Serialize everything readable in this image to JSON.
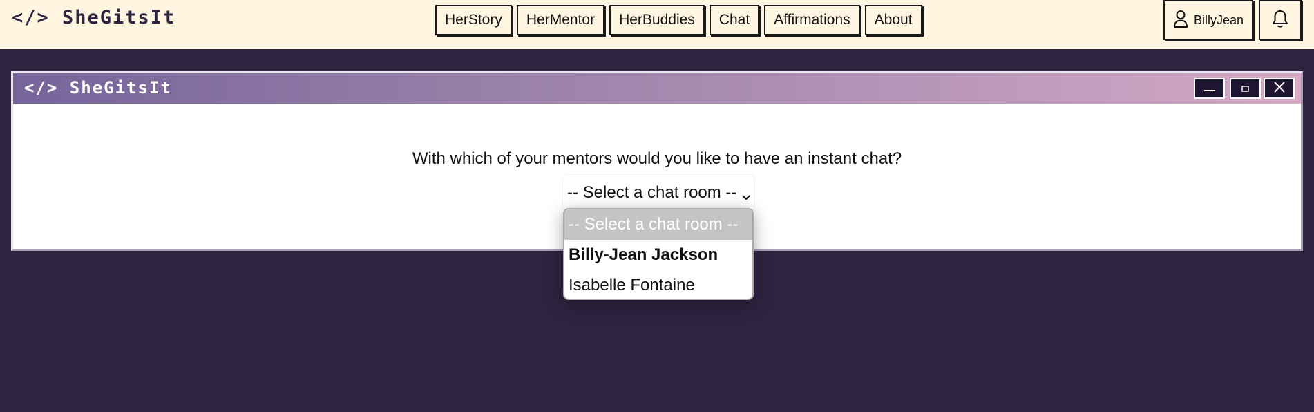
{
  "app": {
    "logo_text": "</> SheGitsIt"
  },
  "nav": {
    "items": [
      {
        "label": "HerStory"
      },
      {
        "label": "HerMentor"
      },
      {
        "label": "HerBuddies"
      },
      {
        "label": "Chat"
      },
      {
        "label": "Affirmations"
      },
      {
        "label": "About"
      }
    ],
    "user_label": "BillyJean"
  },
  "icons": {
    "user": "user-icon",
    "bell": "bell-icon",
    "minimize": "minimize-icon",
    "maximize": "maximize-icon",
    "close": "close-icon",
    "chevron": "chevron-down-icon"
  },
  "window": {
    "title": "</> SheGitsIt",
    "question": "With which of your mentors would you like to have an instant chat?",
    "select_value": "-- Select a chat room --"
  },
  "dropdown": {
    "options": [
      {
        "label": "-- Select a chat room --"
      },
      {
        "label": "Billy-Jean Jackson"
      },
      {
        "label": "Isabelle Fontaine"
      }
    ]
  },
  "colors": {
    "page_background": "#2d2440",
    "topbar_background": "#fff5e1",
    "titlebar_gradient_start": "#76649a",
    "titlebar_gradient_end": "#d6a9c5",
    "window_control_background": "#1e1530",
    "placeholder_option_background": "#c4c4c4"
  }
}
